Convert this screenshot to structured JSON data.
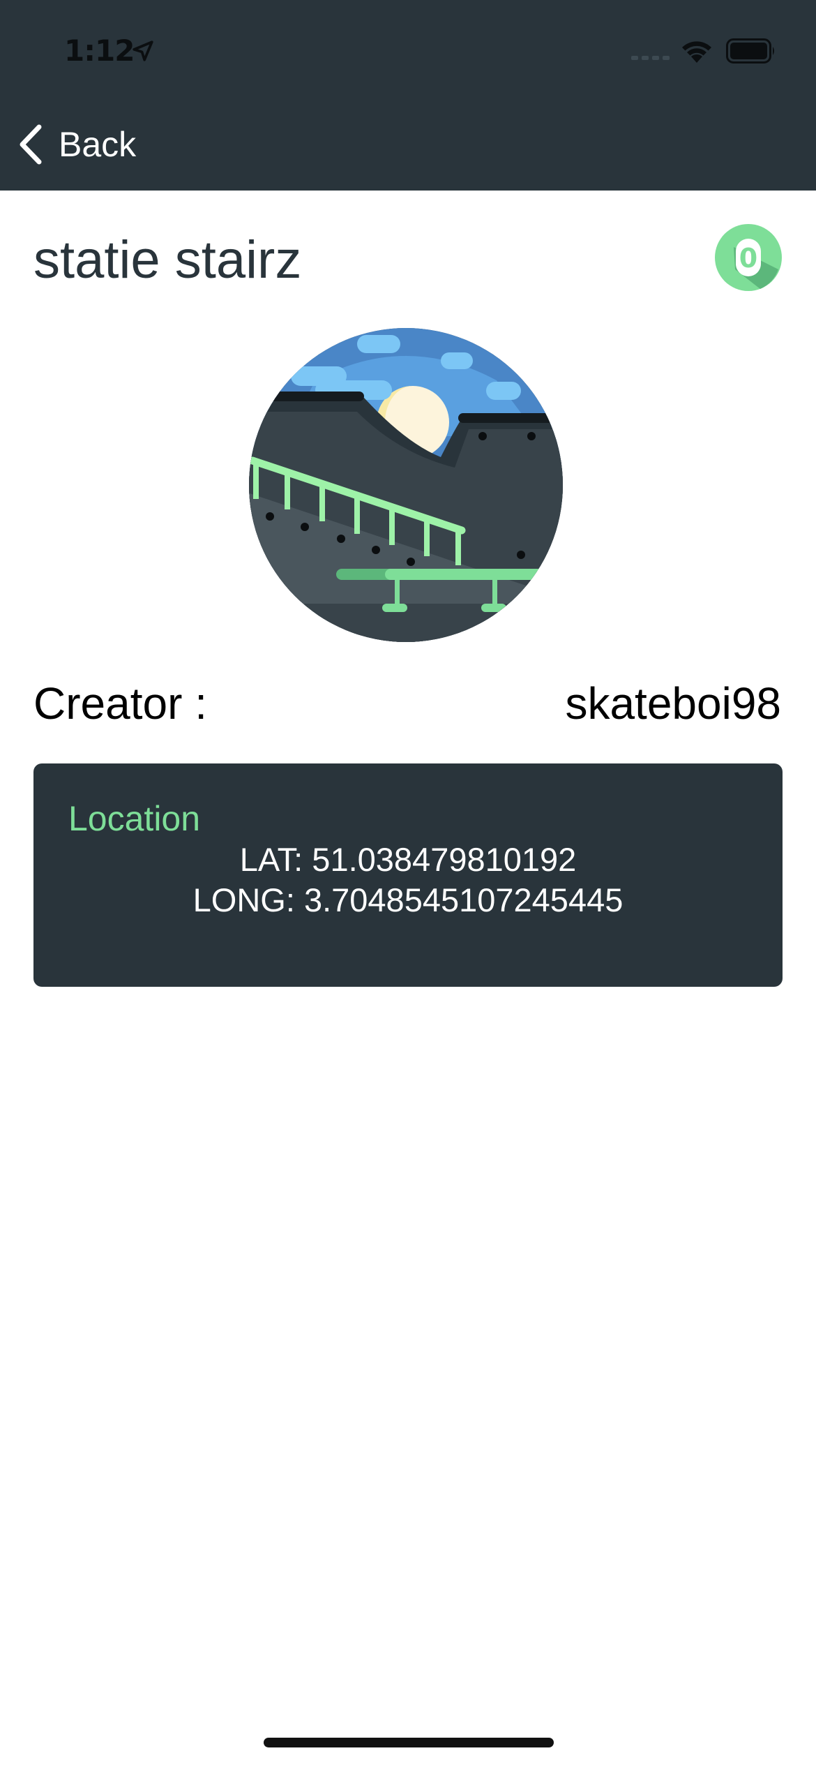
{
  "status_bar": {
    "time": "1:12"
  },
  "nav": {
    "back_label": "Back"
  },
  "spot": {
    "title": "statie stairz",
    "score": "0",
    "creator_label": "Creator :",
    "creator_value": "skateboi98"
  },
  "location": {
    "title": "Location",
    "lat": "LAT: 51.038479810192",
    "long": "LONG: 3.7048545107245445"
  },
  "colors": {
    "header_bg": "#29343b",
    "accent_green": "#7ede98",
    "text_dark": "#29343b",
    "white": "#ffffff"
  },
  "icons": {
    "back": "chevron-left-icon",
    "location_arrow": "location-arrow-icon",
    "wifi": "wifi-icon",
    "battery": "battery-icon",
    "signal": "cellular-signal-icon",
    "spot_illustration": "skatepark-stairs-illustration"
  }
}
